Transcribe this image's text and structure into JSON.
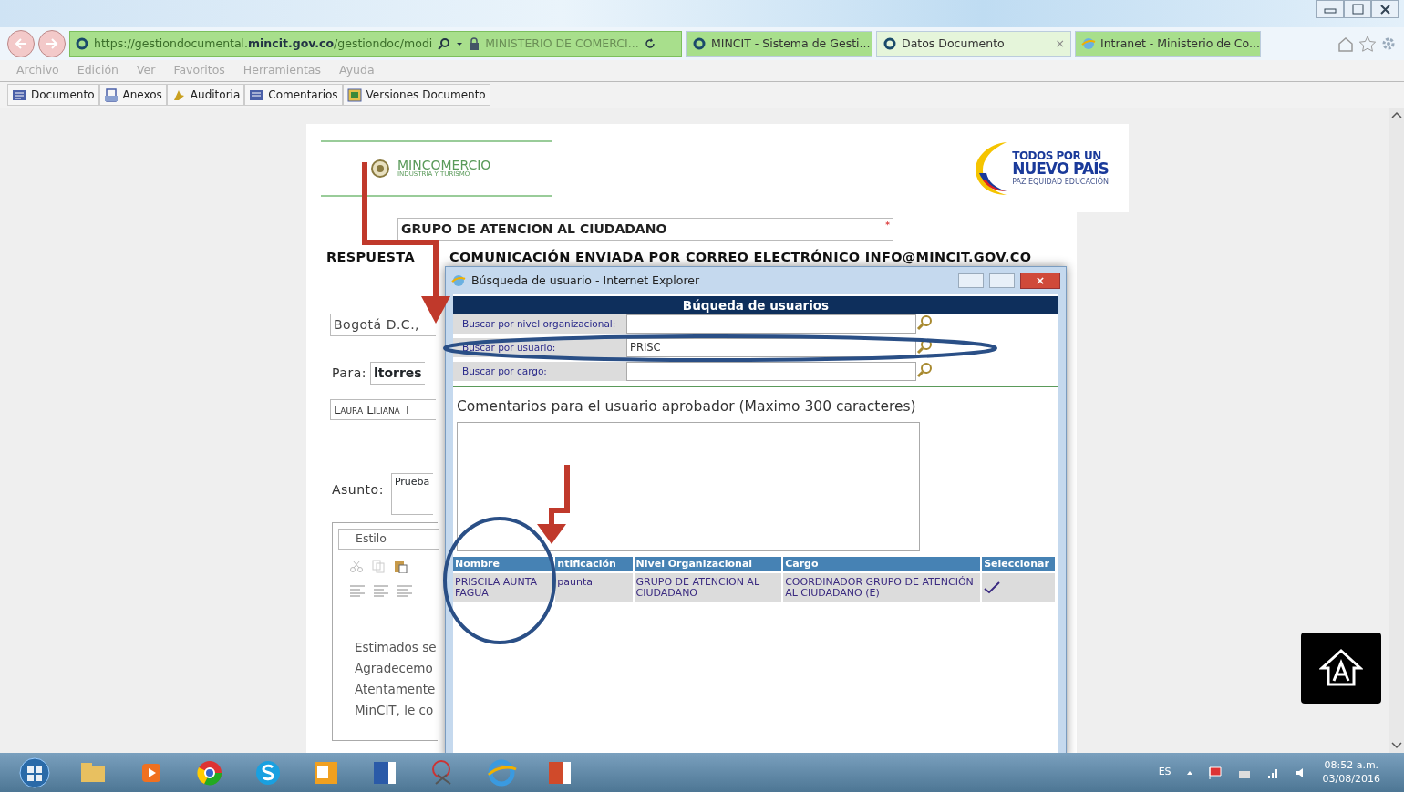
{
  "browser": {
    "address_bar": {
      "url": "https://gestiondocumental.**mincit.gov.co**/gestiondoc/modi",
      "site_identity": "MINISTERIO DE COMERCI..."
    },
    "tabs": [
      {
        "label": "MINCIT - Sistema de Gesti...",
        "selected": false,
        "kind": "site"
      },
      {
        "label": "Datos Documento",
        "selected": true,
        "kind": "site"
      },
      {
        "label": "Intranet - Ministerio de Co...",
        "selected": false,
        "kind": "intranet"
      }
    ],
    "tab_close": "×",
    "menu": [
      "Archivo",
      "Edición",
      "Ver",
      "Favoritos",
      "Herramientas",
      "Ayuda"
    ]
  },
  "toolbar": [
    "Documento",
    "Anexos",
    "Auditoria",
    "Comentarios",
    "Versiones Documento"
  ],
  "document": {
    "logo_name": "MINCOMERCIO",
    "logo_subtitle": "INDUSTRIA Y TURISMO",
    "slogan_top": "TODOS POR UN",
    "slogan_main": "NUEVO PAÍS",
    "slogan_sub": "PAZ EQUIDAD EDUCACIÓN",
    "group_field": "GRUPO DE ATENCION AL CIUDADANO",
    "required_mark": "*",
    "heading": "RESPUESTA COMUNICACIÓN ENVIADA POR CORREO ELECTRÓNICO INFO@MINCIT.GOV.CO",
    "city_field": "Bogotá D.C.,",
    "to_label": "Para:",
    "to_value": "ltorres",
    "name_field": "Laura Liliana T",
    "subject_label": "Asunto:",
    "subject_value": "Prueba",
    "editor": {
      "style_select": "Estilo",
      "lines": [
        "Estimados se",
        "Agradecemo",
        "Atentamente",
        "MinCIT, le co"
      ]
    }
  },
  "dialog": {
    "title": "Búsqueda de usuario - Internet Explorer",
    "header": "Búqueda de usuarios",
    "search_rows": [
      {
        "label": "Buscar por nivel organizacional:"
      },
      {
        "label": "Buscar por usuario:",
        "value": "PRISC"
      },
      {
        "label": "Buscar por cargo:"
      }
    ],
    "comments_label": "Comentarios para el usuario aprobador (Maximo 300 caracteres)",
    "results": {
      "columns": [
        "Nombre",
        "ntificación",
        "Nivel Organizacional",
        "Cargo",
        "Seleccionar"
      ],
      "rows": [
        {
          "name": "PRISCILA AUNTA FAGUA",
          "user": "paunta",
          "org_unit": "GRUPO DE ATENCION AL CIUDADANO",
          "position": "COORDINADOR GRUPO DE ATENCIÓN AL CIUDADANO (E)"
        }
      ]
    }
  },
  "taskbar": {
    "language": "ES",
    "time": "08:52 a.m.",
    "date": "03/08/2016"
  }
}
